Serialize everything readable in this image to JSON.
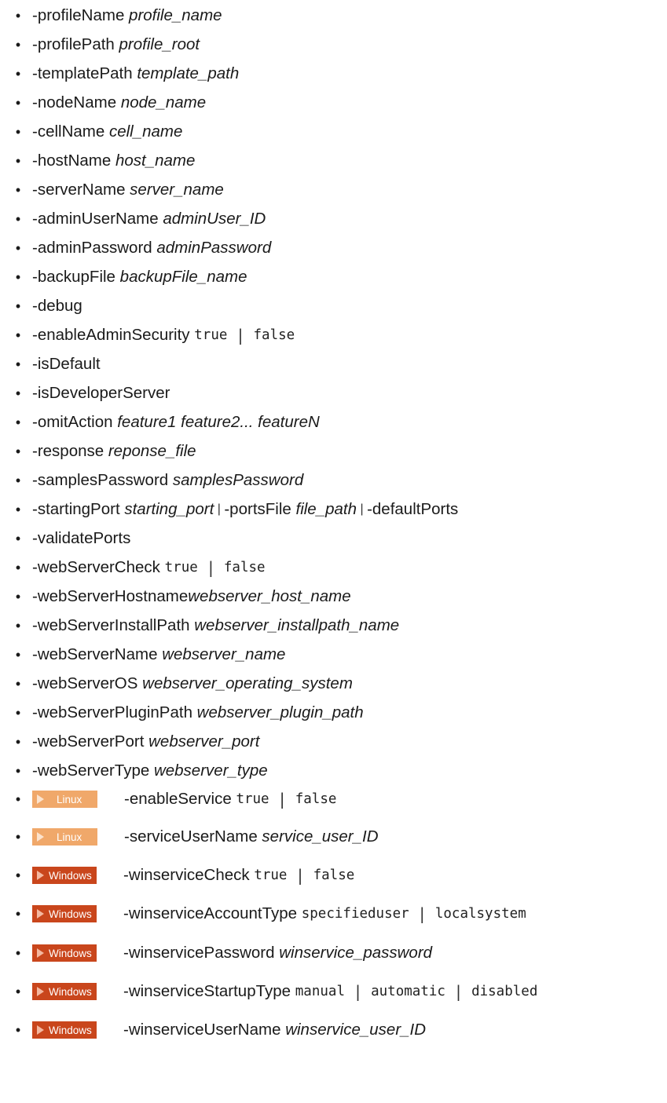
{
  "items": [
    {
      "segments": [
        {
          "text": "-profileName "
        },
        {
          "text": "profile_name",
          "style": "italic"
        }
      ]
    },
    {
      "segments": [
        {
          "text": "-profilePath "
        },
        {
          "text": "profile_root",
          "style": "italic"
        }
      ]
    },
    {
      "segments": [
        {
          "text": "-templatePath "
        },
        {
          "text": "template_path",
          "style": "italic"
        }
      ]
    },
    {
      "segments": [
        {
          "text": "-nodeName "
        },
        {
          "text": "node_name",
          "style": "italic"
        }
      ]
    },
    {
      "segments": [
        {
          "text": "-cellName "
        },
        {
          "text": "cell_name",
          "style": "italic"
        }
      ]
    },
    {
      "segments": [
        {
          "text": "-hostName "
        },
        {
          "text": "host_name",
          "style": "italic"
        }
      ]
    },
    {
      "segments": [
        {
          "text": "-serverName "
        },
        {
          "text": "server_name",
          "style": "italic"
        }
      ]
    },
    {
      "segments": [
        {
          "text": "-adminUserName "
        },
        {
          "text": "adminUser_ID",
          "style": "italic"
        }
      ]
    },
    {
      "segments": [
        {
          "text": "-adminPassword "
        },
        {
          "text": "adminPassword",
          "style": "italic"
        }
      ]
    },
    {
      "segments": [
        {
          "text": "-backupFile "
        },
        {
          "text": "backupFile_name",
          "style": "italic"
        }
      ]
    },
    {
      "segments": [
        {
          "text": "-debug"
        }
      ]
    },
    {
      "segments": [
        {
          "text": "-enableAdminSecurity "
        },
        {
          "text": "true ",
          "style": "mono"
        },
        {
          "text": "|",
          "style": "bar"
        },
        {
          "text": " false",
          "style": "mono"
        }
      ]
    },
    {
      "segments": [
        {
          "text": "-isDefault"
        }
      ]
    },
    {
      "segments": [
        {
          "text": "-isDeveloperServer"
        }
      ]
    },
    {
      "segments": [
        {
          "text": "-omitAction "
        },
        {
          "text": "feature1 feature2... featureN",
          "style": "italic"
        }
      ]
    },
    {
      "segments": [
        {
          "text": "-response "
        },
        {
          "text": "reponse_file",
          "style": "italic"
        }
      ]
    },
    {
      "segments": [
        {
          "text": "-samplesPassword "
        },
        {
          "text": "samplesPassword",
          "style": "italic"
        }
      ]
    },
    {
      "segments": [
        {
          "text": "-startingPort "
        },
        {
          "text": "starting_port",
          "style": "italic"
        },
        {
          "text": " | ",
          "style": "pipe"
        },
        {
          "text": "-portsFile "
        },
        {
          "text": "file_path",
          "style": "italic"
        },
        {
          "text": " | ",
          "style": "pipe"
        },
        {
          "text": "-defaultPorts"
        }
      ]
    },
    {
      "segments": [
        {
          "text": "-validatePorts"
        }
      ]
    },
    {
      "segments": [
        {
          "text": "-webServerCheck "
        },
        {
          "text": "true ",
          "style": "mono"
        },
        {
          "text": "|",
          "style": "bar"
        },
        {
          "text": " false",
          "style": "mono"
        }
      ]
    },
    {
      "segments": [
        {
          "text": "-webServerHostname"
        },
        {
          "text": "webserver_host_name",
          "style": "italic"
        }
      ]
    },
    {
      "segments": [
        {
          "text": "-webServerInstallPath "
        },
        {
          "text": "webserver_installpath_name",
          "style": "italic"
        }
      ]
    },
    {
      "segments": [
        {
          "text": "-webServerName "
        },
        {
          "text": "webserver_name",
          "style": "italic"
        }
      ]
    },
    {
      "segments": [
        {
          "text": "-webServerOS "
        },
        {
          "text": "webserver_operating_system",
          "style": "italic"
        }
      ]
    },
    {
      "segments": [
        {
          "text": "-webServerPluginPath "
        },
        {
          "text": "webserver_plugin_path",
          "style": "italic"
        }
      ]
    },
    {
      "segments": [
        {
          "text": "-webServerPort "
        },
        {
          "text": "webserver_port",
          "style": "italic"
        }
      ]
    },
    {
      "segments": [
        {
          "text": "-webServerType "
        },
        {
          "text": "webserver_type",
          "style": "italic"
        }
      ]
    },
    {
      "badge": "Linux",
      "segments": [
        {
          "text": "-enableService "
        },
        {
          "text": "true ",
          "style": "mono"
        },
        {
          "text": "|",
          "style": "bar"
        },
        {
          "text": " false",
          "style": "mono"
        }
      ]
    },
    {
      "badge": "Linux",
      "segments": [
        {
          "text": "-serviceUserName "
        },
        {
          "text": "service_user_ID",
          "style": "italic"
        }
      ]
    },
    {
      "badge": "Windows",
      "segments": [
        {
          "text": "-winserviceCheck "
        },
        {
          "text": "true ",
          "style": "mono"
        },
        {
          "text": "|",
          "style": "bar"
        },
        {
          "text": " false",
          "style": "mono"
        }
      ]
    },
    {
      "badge": "Windows",
      "segments": [
        {
          "text": "-winserviceAccountType "
        },
        {
          "text": "specifieduser ",
          "style": "mono"
        },
        {
          "text": "|",
          "style": "bar"
        },
        {
          "text": " localsystem",
          "style": "mono"
        }
      ]
    },
    {
      "badge": "Windows",
      "segments": [
        {
          "text": "-winservicePassword "
        },
        {
          "text": "winservice_password",
          "style": "italic"
        }
      ]
    },
    {
      "badge": "Windows",
      "segments": [
        {
          "text": "-winserviceStartupType "
        },
        {
          "text": "manual ",
          "style": "mono"
        },
        {
          "text": "|",
          "style": "bar"
        },
        {
          "text": " automatic ",
          "style": "mono"
        },
        {
          "text": "|",
          "style": "bar"
        },
        {
          "text": " disabled",
          "style": "mono"
        }
      ]
    },
    {
      "badge": "Windows",
      "segments": [
        {
          "text": "-winserviceUserName "
        },
        {
          "text": "winservice_user_ID",
          "style": "italic"
        }
      ]
    }
  ],
  "bullet": "•"
}
